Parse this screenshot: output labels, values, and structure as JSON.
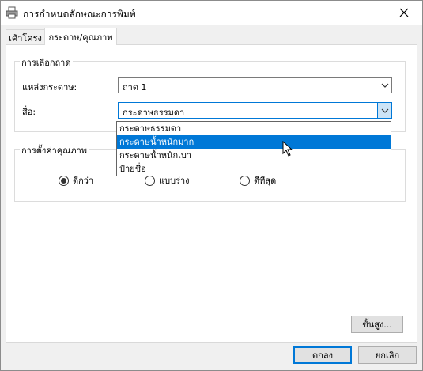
{
  "window": {
    "title": "การกำหนดลักษณะการพิมพ์"
  },
  "tabs": [
    {
      "label": "เค้าโครง",
      "active": false
    },
    {
      "label": "กระดาษ/คุณภาพ",
      "active": true
    }
  ],
  "tray_group": {
    "legend": "การเลือกถาด",
    "source_label": "แหล่งกระดาษ:",
    "source_value": "ถาด 1",
    "media_label": "สื่อ:",
    "media_value": "กระดาษธรรมดา"
  },
  "media_dropdown": {
    "options": [
      "กระดาษธรรมดา",
      "กระดาษน้ำหนักมาก",
      "กระดาษน้ำหนักเบา",
      "ป้ายชื่อ"
    ],
    "highlighted_index": 1
  },
  "quality_group": {
    "legend": "การตั้งค่าคุณภาพ",
    "options": [
      "ดีกว่า",
      "แบบร่าง",
      "ดีที่สุด"
    ],
    "selected_index": 0
  },
  "buttons": {
    "advanced": "ขั้นสูง...",
    "ok": "ตกลง",
    "cancel": "ยกเลิก"
  },
  "colors": {
    "accent": "#0078d7",
    "highlight_text": "#ffffff"
  }
}
